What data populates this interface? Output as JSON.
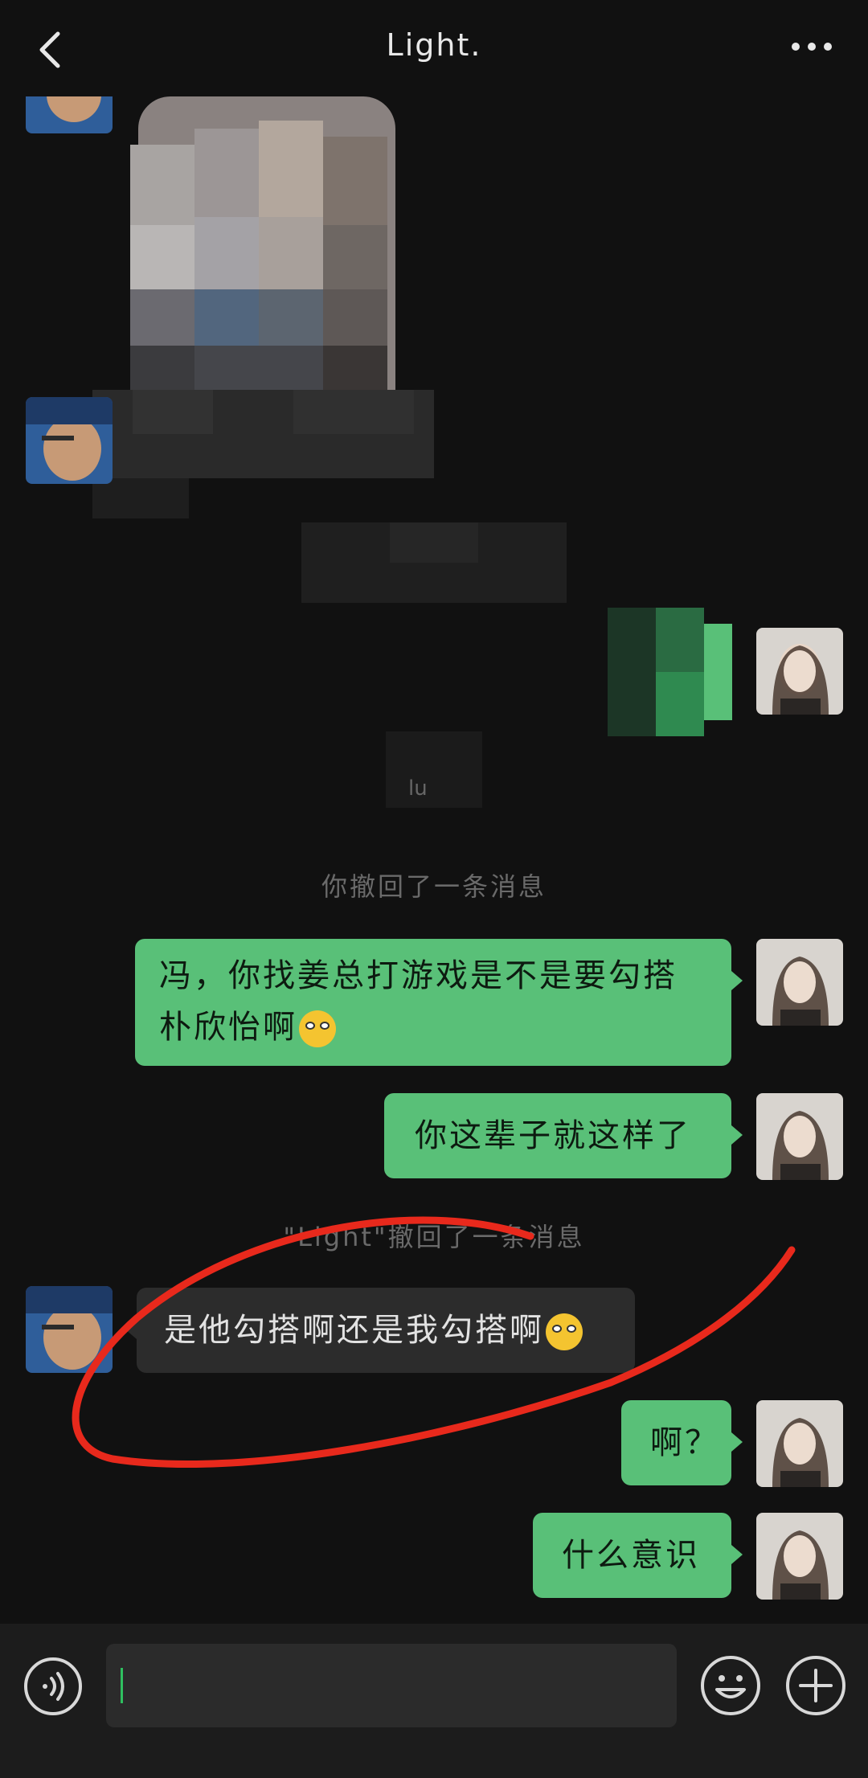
{
  "header": {
    "title": "Light."
  },
  "messages": {
    "m1": "冯，你找姜总打游戏是不是要勾搭朴欣怡啊",
    "m2": "你这辈子就这样了",
    "m3": "是他勾搭啊还是我勾搭啊",
    "m4": "啊？",
    "m5": "什么意识"
  },
  "system": {
    "recall_self": "你撤回了一条消息",
    "recall_other": "\"Light\"撤回了一条消息",
    "blur_fragment": "lu"
  },
  "icons": {
    "back": "chevron-left-icon",
    "more": "more-dots-icon",
    "voice": "voice-icon",
    "emoji": "emoji-icon",
    "plus": "plus-icon",
    "m1_emoji": "smirk-emoji",
    "m3_emoji": "laugh-cry-emoji"
  },
  "colors": {
    "background": "#111111",
    "outgoing_bubble": "#59c078",
    "incoming_bubble": "#2c2c2c",
    "annotation": "#e8291c"
  }
}
